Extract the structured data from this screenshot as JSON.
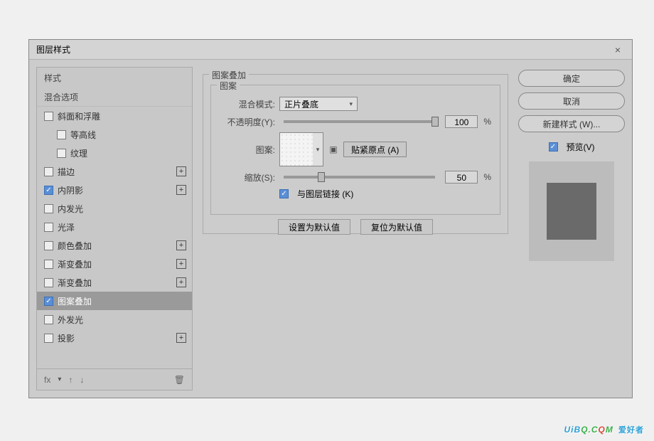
{
  "dialog": {
    "title": "图层样式",
    "close": "×"
  },
  "styles": {
    "header": "样式",
    "blend": "混合选项",
    "items": [
      {
        "label": "斜面和浮雕",
        "checked": false,
        "plus": false,
        "indent": 1
      },
      {
        "label": "等高线",
        "checked": false,
        "plus": false,
        "indent": 2
      },
      {
        "label": "纹理",
        "checked": false,
        "plus": false,
        "indent": 2
      },
      {
        "label": "描边",
        "checked": false,
        "plus": true,
        "indent": 1
      },
      {
        "label": "内阴影",
        "checked": true,
        "plus": true,
        "indent": 1
      },
      {
        "label": "内发光",
        "checked": false,
        "plus": false,
        "indent": 1
      },
      {
        "label": "光泽",
        "checked": false,
        "plus": false,
        "indent": 1
      },
      {
        "label": "颜色叠加",
        "checked": false,
        "plus": true,
        "indent": 1
      },
      {
        "label": "渐变叠加",
        "checked": false,
        "plus": true,
        "indent": 1
      },
      {
        "label": "渐变叠加",
        "checked": false,
        "plus": true,
        "indent": 1
      },
      {
        "label": "图案叠加",
        "checked": true,
        "plus": false,
        "indent": 1,
        "selected": true
      },
      {
        "label": "外发光",
        "checked": false,
        "plus": false,
        "indent": 1
      },
      {
        "label": "投影",
        "checked": false,
        "plus": true,
        "indent": 1
      }
    ],
    "tools": {
      "fx": "fx",
      "up": "↑",
      "down": "↓",
      "trash": "🗑"
    }
  },
  "pattern": {
    "groupTitle": "图案叠加",
    "innerTitle": "图案",
    "blendLabel": "混合模式:",
    "blendValue": "正片叠底",
    "opacityLabel": "不透明度(Y):",
    "opacityValue": "100",
    "opacityPos": 100,
    "pct": "%",
    "swatchLabel": "图案:",
    "snap": "贴紧原点 (A)",
    "scaleLabel": "缩放(S):",
    "scaleValue": "50",
    "scalePos": 50,
    "linkLabel": "与图层链接 (K)",
    "linkChecked": true,
    "defaults": "设置为默认值",
    "reset": "复位为默认值"
  },
  "right": {
    "ok": "确定",
    "cancel": "取消",
    "newStyle": "新建样式 (W)...",
    "previewLabel": "预览(V)",
    "previewChecked": true
  },
  "watermark": {
    "a": "UiB",
    "b": "Q.C",
    "c": "Q",
    "d": "M",
    "e": "爱好者"
  }
}
